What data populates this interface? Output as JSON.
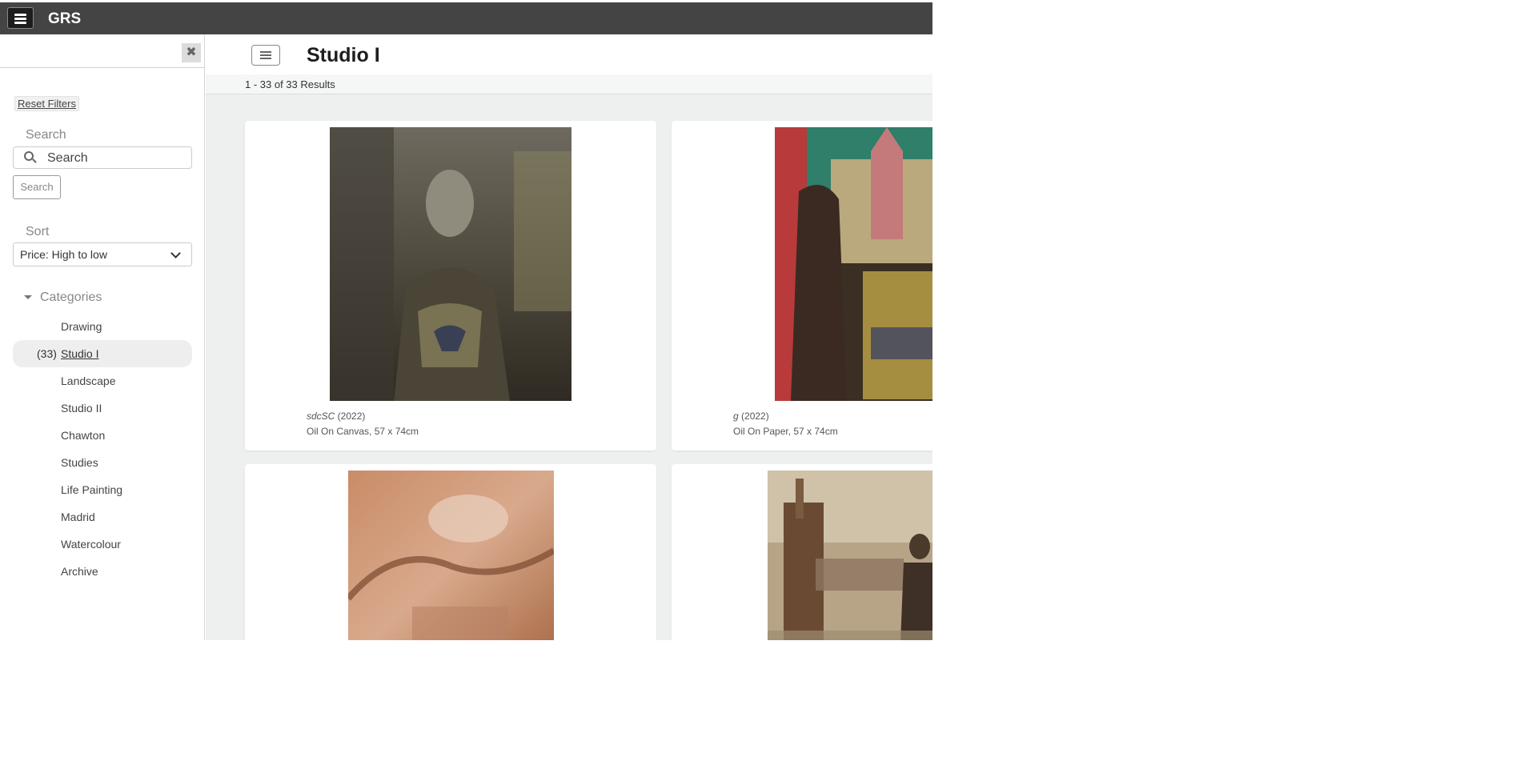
{
  "app": {
    "brand": "GRS"
  },
  "sidebar": {
    "reset_label": "Reset Filters",
    "search_label": "Search",
    "search_placeholder": "Search",
    "search_button": "Search",
    "sort_label": "Sort",
    "sort_value": "Price: High to low",
    "categories_label": "Categories",
    "categories": [
      {
        "label": "Drawing",
        "count": ""
      },
      {
        "label": "Studio I",
        "count": "(33)"
      },
      {
        "label": "Landscape",
        "count": ""
      },
      {
        "label": "Studio II",
        "count": ""
      },
      {
        "label": "Chawton",
        "count": ""
      },
      {
        "label": "Studies",
        "count": ""
      },
      {
        "label": "Life Painting",
        "count": ""
      },
      {
        "label": "Madrid",
        "count": ""
      },
      {
        "label": "Watercolour",
        "count": ""
      },
      {
        "label": "Archive",
        "count": ""
      }
    ]
  },
  "main": {
    "title": "Studio I",
    "results": "1 - 33 of 33 Results",
    "items": [
      {
        "title": "sdcSC",
        "year": " (2022)",
        "details": "Oil On Canvas, 57 x 74cm"
      },
      {
        "title": "g",
        "year": " (2022)",
        "details": "Oil On Paper, 57 x 74cm"
      },
      {
        "title": "",
        "year": "",
        "details": ""
      },
      {
        "title": "",
        "year": "",
        "details": ""
      }
    ]
  },
  "colors": {
    "topbar": "#444444",
    "content_bg": "#eef0f0",
    "active_category_bg": "#eeeeee"
  }
}
